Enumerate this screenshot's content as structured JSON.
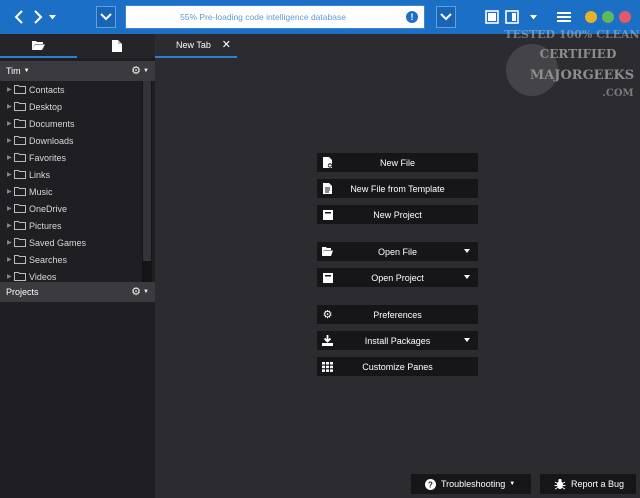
{
  "topbar": {
    "notification": "55% Pre-loading code intelligence database",
    "info_glyph": "!"
  },
  "left_panel": {
    "user_section": {
      "label": "Tim"
    },
    "folders": [
      "Contacts",
      "Desktop",
      "Documents",
      "Downloads",
      "Favorites",
      "Links",
      "Music",
      "OneDrive",
      "Pictures",
      "Saved Games",
      "Searches",
      "Videos"
    ],
    "projects_section": {
      "label": "Projects"
    }
  },
  "main": {
    "tab": {
      "label": "New Tab",
      "close_glyph": "✕"
    },
    "actions": [
      {
        "label": "New File",
        "icon": "new-file-icon",
        "dropdown": false
      },
      {
        "label": "New File from Template",
        "icon": "template-file-icon",
        "dropdown": false
      },
      {
        "label": "New Project",
        "icon": "new-project-icon",
        "dropdown": false
      },
      {
        "label": "Open File",
        "icon": "open-folder-icon",
        "dropdown": true
      },
      {
        "label": "Open Project",
        "icon": "project-icon",
        "dropdown": true
      },
      {
        "label": "Preferences",
        "icon": "gear-icon",
        "dropdown": false
      },
      {
        "label": "Install Packages",
        "icon": "download-icon",
        "dropdown": true
      },
      {
        "label": "Customize Panes",
        "icon": "grid-icon",
        "dropdown": false
      }
    ]
  },
  "footer": {
    "troubleshooting_label": "Troubleshooting",
    "report_bug_label": "Report a Bug"
  },
  "watermark": {
    "line1": "TESTED 100% CLEAN",
    "line2": "CERTIFIED",
    "line3": "MAJORGEEKS",
    "line4": ".COM"
  },
  "colors": {
    "accent": "#1b70c6",
    "panel_bg": "#1f1f23",
    "main_bg": "#2b2b30",
    "button_bg": "#161618",
    "minimize": "#e8b12a",
    "maximize": "#5fb85a",
    "close": "#e05a68"
  }
}
